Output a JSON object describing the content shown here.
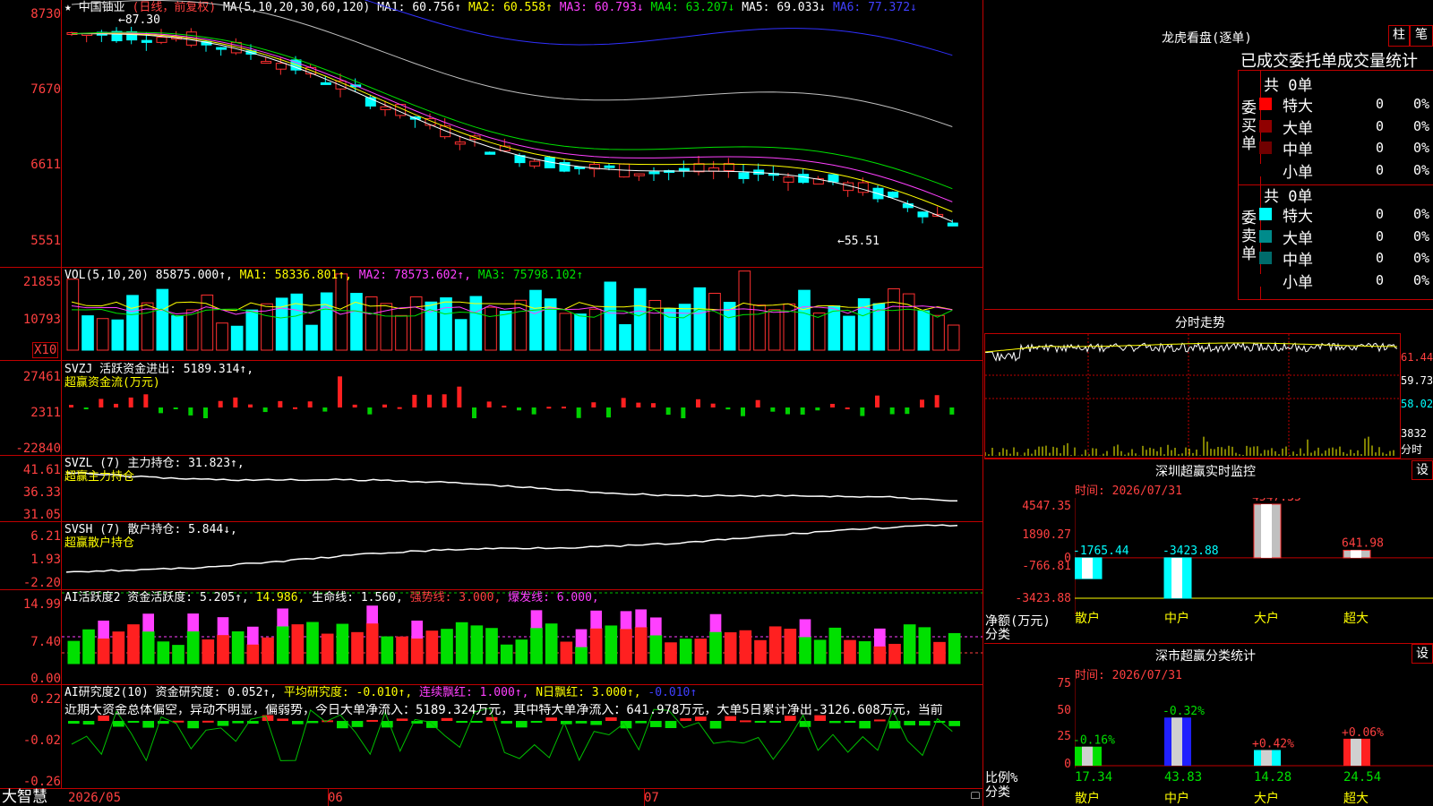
{
  "left": {
    "y_main": [
      "8730",
      "7670",
      "6611",
      "5551"
    ],
    "y_vol": [
      "21855",
      "10793"
    ],
    "vol_unit": "X10",
    "y_svzj": [
      "27461",
      "2311",
      "-22840"
    ],
    "y_svzl": [
      "41.61",
      "36.33",
      "31.05"
    ],
    "y_svsh": [
      "6.21",
      "1.93",
      "-2.20"
    ],
    "y_ai2": [
      "14.99",
      "7.40",
      "0.00"
    ],
    "y_ai3": [
      "0.22",
      "-0.02",
      "-0.26"
    ],
    "x_axis": [
      "2026/05",
      "06",
      "07"
    ],
    "logo": "大智慧"
  },
  "main": {
    "star": "★",
    "stock_name": "中国铀业",
    "period": "(日线，前复权)",
    "ma_label": "MA(5,10,20,30,60,120)",
    "ma1": "MA1: 60.756↑",
    "ma2": "MA2: 60.558↑",
    "ma3": "MA3: 60.793↓",
    "ma4": "MA4: 63.207↓",
    "ma5": "MA5: 69.033↓",
    "ma6": "MA6: 77.372↓",
    "high_label": "←87.30",
    "low_label": "←55.51"
  },
  "vol": {
    "label": "VOL(5,10,20)",
    "value": "85875.000↑,",
    "ma1": "MA1: 58336.801↑,",
    "ma2": "MA2: 78573.602↑,",
    "ma3": "MA3: 75798.102↑"
  },
  "svzj": {
    "label": "SVZJ  活跃资金进出: 5189.314↑,",
    "sub": "超赢资金流(万元)"
  },
  "svzl": {
    "label": "SVZL (7) 主力持仓: 31.823↑,",
    "sub": "超赢主力持仓"
  },
  "svsh": {
    "label": "SVSH (7) 散户持仓: 5.844↓,",
    "sub": "超赢散户持仓"
  },
  "ai2": {
    "label": "AI活跃度2 资金活跃度: 5.205↑,",
    "v2": "14.986,",
    "life": "生命线: 1.560,",
    "strong": "强势线: 3.000,",
    "burst": "爆发线: 6.000,"
  },
  "ai3": {
    "label": "AI研究度2(10) 资金研究度: 0.052↑,",
    "avg": "平均研究度: -0.010↑,",
    "cont": "连续飘红: 1.000↑,",
    "nday": "N日飘红: 3.000↑,",
    "last": "-0.010↑",
    "comment": "近期大资金总体偏空，异动不明显，偏弱势，今日大单净流入：5189.324万元，其中特大单净流入：641.978万元，大单5日累计净出-3126.608万元，当前"
  },
  "right": {
    "lhb_title": "龙虎看盘(逐单)",
    "btn_bar": "柱",
    "btn_pen": "笔",
    "deal_title": "已成交委托单成交量统计",
    "buy_total": "共 0单",
    "sell_total": "共 0单",
    "buy_side": "委买单",
    "sell_side": "委卖单",
    "buy_rows": [
      {
        "name": "特大",
        "count": "0",
        "pct": "0%",
        "color": "#ff0000"
      },
      {
        "name": "大单",
        "count": "0",
        "pct": "0%",
        "color": "#900000"
      },
      {
        "name": "中单",
        "count": "0",
        "pct": "0%",
        "color": "#700000"
      },
      {
        "name": "小单",
        "count": "0",
        "pct": "0%",
        "color": "#000000"
      }
    ],
    "sell_rows": [
      {
        "name": "特大",
        "count": "0",
        "pct": "0%",
        "color": "#00ffff"
      },
      {
        "name": "大单",
        "count": "0",
        "pct": "0%",
        "color": "#008b8b"
      },
      {
        "name": "中单",
        "count": "0",
        "pct": "0%",
        "color": "#006b6b"
      },
      {
        "name": "小单",
        "count": "0",
        "pct": "0%",
        "color": "#000000"
      }
    ],
    "intraday_title": "分时走势",
    "intraday_y": [
      "61.44",
      "59.73",
      "58.02",
      "3832",
      "分时"
    ],
    "sz_title": "深圳超赢实时监控",
    "set_label": "设",
    "sz_time": "时间: 2026/07/31",
    "sz_y": [
      "4547.35",
      "1890.27",
      "0",
      "-766.81",
      "-3423.88"
    ],
    "sz_axis_name": "净额(万元)",
    "sz_axis_cat": "分类",
    "sz_values": [
      "-1765.44",
      "-3423.88",
      "4547.35",
      "641.98"
    ],
    "categories": [
      "散户",
      "中户",
      "大户",
      "超大"
    ],
    "ss_title": "深市超赢分类统计",
    "ss_time": "时间: 2026/07/31",
    "ss_y": [
      "75",
      "50",
      "25",
      "0"
    ],
    "ss_axis_name": "比例%",
    "ss_axis_cat": "分类",
    "ss_top": [
      "-0.16%",
      "-0.32%",
      "+0.42%",
      "+0.06%"
    ],
    "ss_values": [
      "17.34",
      "43.83",
      "14.28",
      "24.54"
    ]
  },
  "chart_data": {
    "type": "bar",
    "title": "深圳超赢实时监控",
    "categories": [
      "散户",
      "中户",
      "大户",
      "超大"
    ],
    "values": [
      -1765.44,
      -3423.88,
      4547.35,
      641.98
    ],
    "ylabel": "净额(万元)",
    "ylim": [
      -3423.88,
      4547.35
    ]
  },
  "chart_data_2": {
    "type": "bar",
    "title": "深市超赢分类统计",
    "categories": [
      "散户",
      "中户",
      "大户",
      "超大"
    ],
    "values": [
      17.34,
      43.83,
      14.28,
      24.54
    ],
    "changes": [
      -0.16,
      -0.32,
      0.42,
      0.06
    ],
    "ylabel": "比例%",
    "ylim": [
      0,
      75
    ]
  }
}
